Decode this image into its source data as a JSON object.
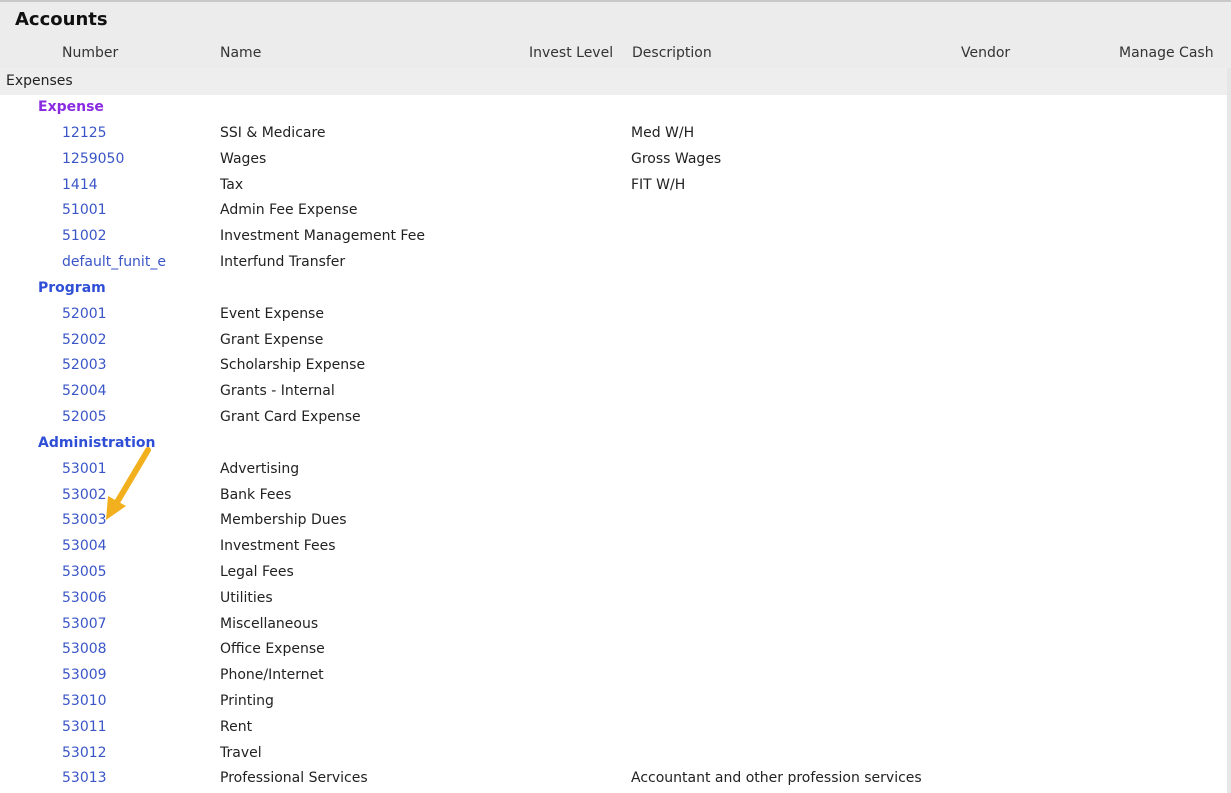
{
  "window": {
    "title": "Accounts"
  },
  "columns": {
    "number": "Number",
    "name": "Name",
    "invest_level": "Invest Level",
    "description": "Description",
    "vendor": "Vendor",
    "manage_cash": "Manage Cash"
  },
  "section": {
    "label": "Expenses"
  },
  "groups": [
    {
      "label": "Expense",
      "color": "#8a2be2",
      "accounts": [
        {
          "number": "12125",
          "name": "SSI & Medicare",
          "description": "Med W/H"
        },
        {
          "number": "1259050",
          "name": "Wages",
          "description": "Gross Wages"
        },
        {
          "number": "1414",
          "name": "Tax",
          "description": "FIT W/H"
        },
        {
          "number": "51001",
          "name": "Admin Fee Expense",
          "description": ""
        },
        {
          "number": "51002",
          "name": "Investment Management Fee",
          "description": ""
        },
        {
          "number": "default_funit_e",
          "name": "Interfund Transfer",
          "description": ""
        }
      ]
    },
    {
      "label": "Program",
      "color": "#2f4fd6",
      "accounts": [
        {
          "number": "52001",
          "name": "Event Expense",
          "description": ""
        },
        {
          "number": "52002",
          "name": "Grant Expense",
          "description": ""
        },
        {
          "number": "52003",
          "name": "Scholarship Expense",
          "description": ""
        },
        {
          "number": "52004",
          "name": "Grants - Internal",
          "description": ""
        },
        {
          "number": "52005",
          "name": "Grant Card Expense",
          "description": ""
        }
      ]
    },
    {
      "label": "Administration",
      "color": "#2f4fd6",
      "accounts": [
        {
          "number": "53001",
          "name": "Advertising",
          "description": ""
        },
        {
          "number": "53002",
          "name": "Bank Fees",
          "description": ""
        },
        {
          "number": "53003",
          "name": "Membership Dues",
          "description": ""
        },
        {
          "number": "53004",
          "name": "Investment Fees",
          "description": ""
        },
        {
          "number": "53005",
          "name": "Legal Fees",
          "description": ""
        },
        {
          "number": "53006",
          "name": "Utilities",
          "description": ""
        },
        {
          "number": "53007",
          "name": "Miscellaneous",
          "description": ""
        },
        {
          "number": "53008",
          "name": "Office Expense",
          "description": ""
        },
        {
          "number": "53009",
          "name": "Phone/Internet",
          "description": ""
        },
        {
          "number": "53010",
          "name": "Printing",
          "description": ""
        },
        {
          "number": "53011",
          "name": "Rent",
          "description": ""
        },
        {
          "number": "53012",
          "name": "Travel",
          "description": ""
        },
        {
          "number": "53013",
          "name": "Professional Services",
          "description": "Accountant and other profession services"
        }
      ]
    }
  ],
  "colors": {
    "link": "#3a55c7",
    "annotation_arrow": "#f2b01e"
  },
  "icons": {
    "annotation": "arrow-annotation-icon"
  }
}
